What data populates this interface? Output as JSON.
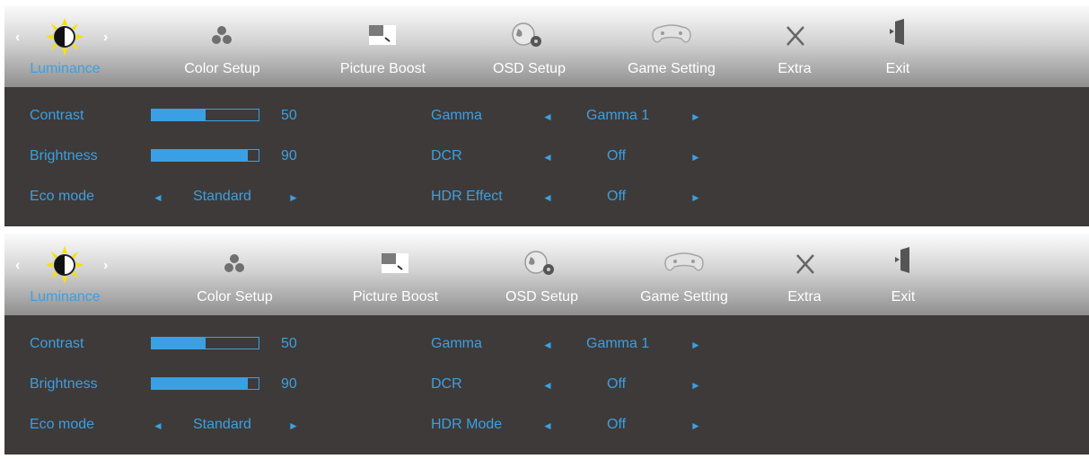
{
  "tabs": [
    {
      "label": "Luminance",
      "icon": "sun-contrast-icon"
    },
    {
      "label": "Color Setup",
      "icon": "color-dots-icon"
    },
    {
      "label": "Picture Boost",
      "icon": "picture-boost-icon"
    },
    {
      "label": "OSD Setup",
      "icon": "globe-gear-icon"
    },
    {
      "label": "Game Setting",
      "icon": "gamepad-icon"
    },
    {
      "label": "Extra",
      "icon": "tools-icon"
    },
    {
      "label": "Exit",
      "icon": "exit-door-icon"
    }
  ],
  "nav_arrows": {
    "left": "‹",
    "right": "›"
  },
  "panels": [
    {
      "contrast": {
        "label": "Contrast",
        "value": "50",
        "level": 0.5
      },
      "brightness": {
        "label": "Brightness",
        "value": "90",
        "level": 0.9
      },
      "eco": {
        "label": "Eco mode",
        "value": "Standard"
      },
      "gamma": {
        "label": "Gamma",
        "value": "Gamma 1"
      },
      "dcr": {
        "label": "DCR",
        "value": "Off"
      },
      "hdr": {
        "label": "HDR Effect",
        "value": "Off"
      }
    },
    {
      "contrast": {
        "label": "Contrast",
        "value": "50",
        "level": 0.5
      },
      "brightness": {
        "label": "Brightness",
        "value": "90",
        "level": 0.9
      },
      "eco": {
        "label": "Eco mode",
        "value": "Standard"
      },
      "gamma": {
        "label": "Gamma",
        "value": "Gamma 1"
      },
      "dcr": {
        "label": "DCR",
        "value": "Off"
      },
      "hdr": {
        "label": "HDR Mode",
        "value": "Off"
      }
    }
  ],
  "colors": {
    "accent": "#3aa0e3",
    "panel_bg": "#3e3a39",
    "sun": "#f5e100"
  }
}
